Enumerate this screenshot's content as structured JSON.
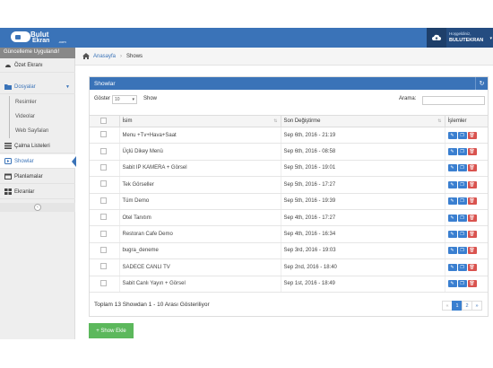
{
  "header": {
    "logo_line1": "Bulut",
    "logo_line2": "Ekran",
    "logo_suffix": ".com",
    "greeting": "Hoşgeldiniz,",
    "username": "BULUTEKRAN"
  },
  "sidebar": {
    "update_notice": "Güncelleme Uygulandı!",
    "items": [
      {
        "label": "Özet Ekranı",
        "icon": "dashboard-icon"
      },
      {
        "label": "Dosyalar",
        "icon": "folder-icon"
      },
      {
        "label": "Çalma Listeleri",
        "icon": "list-icon"
      },
      {
        "label": "Showlar",
        "icon": "play-icon"
      },
      {
        "label": "Planlamalar",
        "icon": "calendar-icon"
      },
      {
        "label": "Ekranlar",
        "icon": "grid-icon"
      }
    ],
    "subitems": [
      {
        "label": "Resimler"
      },
      {
        "label": "Videolar"
      },
      {
        "label": "Web Sayfaları"
      }
    ]
  },
  "breadcrumb": {
    "home": "Anasayfa",
    "current": "Shows"
  },
  "panel": {
    "title": "Showlar",
    "show_prefix": "Göster",
    "show_count": "10",
    "show_suffix": "Show",
    "search_label": "Arama:",
    "search_value": ""
  },
  "table": {
    "headers": [
      "İsim",
      "Son Değiştirme",
      "İşlemler"
    ],
    "rows": [
      {
        "name": "Menu +Tv+Hava+Saat",
        "modified": "Sep 6th, 2016 - 21:19"
      },
      {
        "name": "Üçlü Dikey Menü",
        "modified": "Sep 6th, 2016 - 08:58"
      },
      {
        "name": "Sabit IP KAMERA + Görsel",
        "modified": "Sep 5th, 2016 - 19:01"
      },
      {
        "name": "Tek Görseller",
        "modified": "Sep 5th, 2016 - 17:27"
      },
      {
        "name": "Tüm Demo",
        "modified": "Sep 5th, 2016 - 19:39"
      },
      {
        "name": "Otel Tanıtım",
        "modified": "Sep 4th, 2016 - 17:27"
      },
      {
        "name": "Restoran Cafe Demo",
        "modified": "Sep 4th, 2016 - 16:34"
      },
      {
        "name": "bugra_deneme",
        "modified": "Sep 3rd, 2016 - 19:03"
      },
      {
        "name": "SADECE CANLI TV",
        "modified": "Sep 2nd, 2016 - 18:40"
      },
      {
        "name": "Sabit Canlı Yayın + Görsel",
        "modified": "Sep 1st, 2016 - 18:49"
      }
    ]
  },
  "footer": {
    "summary": "Toplam 13 Showdan 1 - 10 Arası Gösteriliyor",
    "pages": [
      "«",
      "1",
      "2",
      "»"
    ],
    "add_button": "+ Show Ekle"
  },
  "colors": {
    "primary": "#3a73b8",
    "danger": "#d9534f",
    "success": "#5cb85c"
  }
}
